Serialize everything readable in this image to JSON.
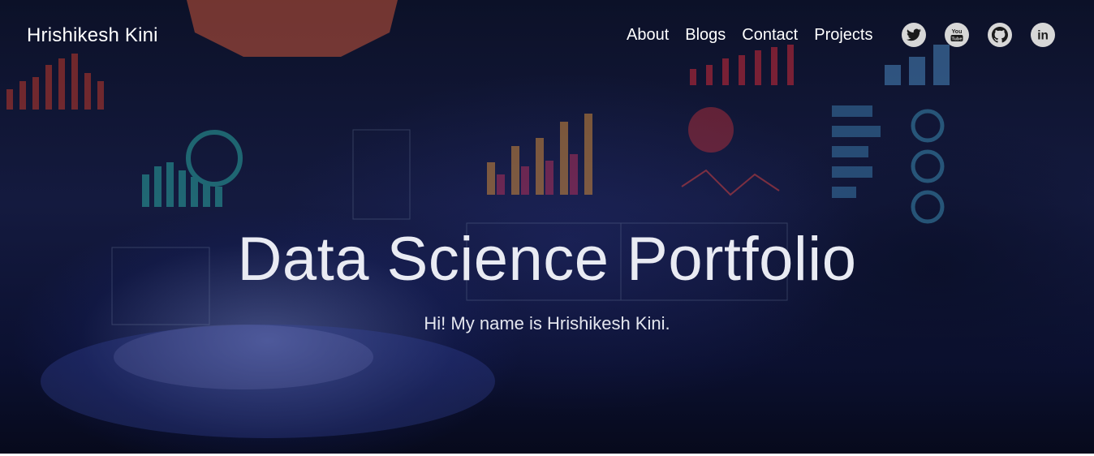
{
  "header": {
    "brand": "Hrishikesh Kini",
    "nav": [
      {
        "label": "About"
      },
      {
        "label": "Blogs"
      },
      {
        "label": "Contact"
      },
      {
        "label": "Projects"
      }
    ],
    "social": [
      {
        "name": "twitter-icon"
      },
      {
        "name": "youtube-icon",
        "text": "You\nTube"
      },
      {
        "name": "github-icon"
      },
      {
        "name": "linkedin-icon",
        "text": "in"
      }
    ]
  },
  "hero": {
    "title": "Data Science Portfolio",
    "subtitle": "Hi! My name is Hrishikesh Kini."
  },
  "colors": {
    "nav_text": "#ffffff",
    "icon_bg": "#d7d7d7",
    "icon_fg": "#1a1a1a",
    "hero_bg": "#0f1433"
  }
}
